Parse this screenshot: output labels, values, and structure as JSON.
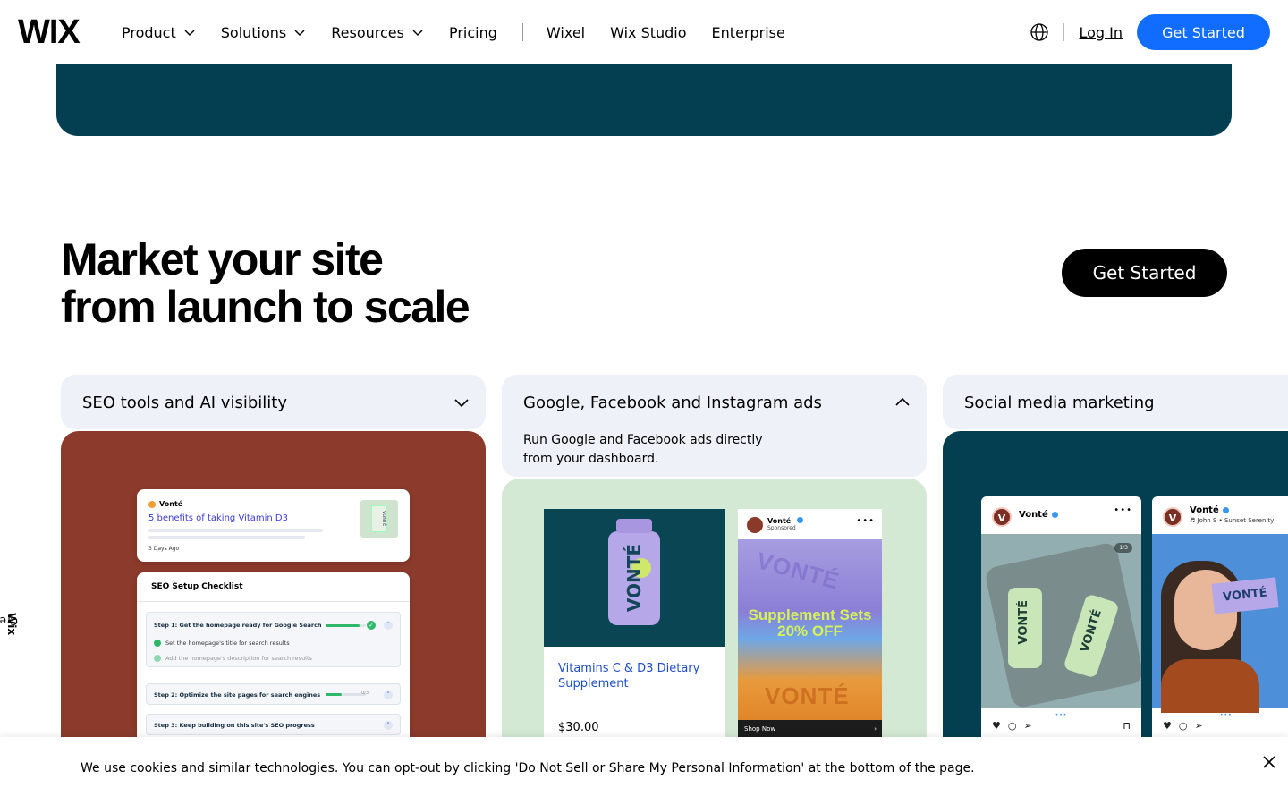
{
  "header": {
    "logo": "WIX",
    "nav": [
      {
        "label": "Product",
        "has_dropdown": true
      },
      {
        "label": "Solutions",
        "has_dropdown": true
      },
      {
        "label": "Resources",
        "has_dropdown": true
      },
      {
        "label": "Pricing",
        "has_dropdown": false
      }
    ],
    "nav_secondary": [
      "Wixel",
      "Wix Studio",
      "Enterprise"
    ],
    "login": "Log In",
    "cta": "Get Started",
    "cta_color": "#116dff"
  },
  "banner": {
    "color": "#033f50"
  },
  "section": {
    "title_line1": "Market your site",
    "title_line2": "from launch to scale",
    "cta": "Get Started"
  },
  "cards": [
    {
      "label": "SEO tools and AI visibility",
      "expanded": false,
      "body_color": "#8b3a2b",
      "mock": {
        "brand": "Vonté",
        "article_title": "5 benefits of taking Vitamin D3",
        "article_date": "3 Days Ago",
        "thumb_text": "VONTÉ",
        "checklist_title": "SEO Setup Checklist",
        "step1": "Step 1:  Get the homepage ready for Google Search",
        "step1_item1": "Set the homepage's title for search results",
        "step1_item2": "Add the homepage's description for search results",
        "step2": "Step 2:  Optimize the site pages for search engines",
        "step2_progress_text": "0/3",
        "step3": "Step 3:  Keep building on this site's SEO progress",
        "step1_progress": 0.85,
        "step2_progress": 0.4
      }
    },
    {
      "label": "Google, Facebook and Instagram ads",
      "expanded": true,
      "description": "Run Google and Facebook ads directly from your dashboard.",
      "body_color": "#d3e9d3",
      "mock": {
        "bottle_text": "VONTÉ",
        "product_title": "Vitamins C & D3 Dietary Supplement",
        "price": "$30.00",
        "fb_brand": "Vonté",
        "fb_sponsored": "Sponsored",
        "fb_promo": "Supplement Sets 20% OFF",
        "fb_watermark": "VONTÉ",
        "fb_cta": "Shop Now"
      }
    },
    {
      "label": "Social media marketing",
      "expanded": false,
      "body_color": "#033f50",
      "mock": {
        "post1_avatar": "V",
        "post1_name": "Vonté",
        "post1_counter": "1/3",
        "post1_bottle_text": "VONTÉ",
        "post2_avatar": "V",
        "post2_name": "Vonté",
        "post2_sub": "♬ John S • Sunset Serenity",
        "post2_box_text": "VONTÉ"
      }
    }
  ],
  "side_label": {
    "prefix": "Created with ",
    "brand": "Wix"
  },
  "cookie": {
    "text": "We use cookies and similar technologies. You can opt-out by clicking 'Do Not Sell or Share My Personal Information' at the bottom of the page."
  }
}
